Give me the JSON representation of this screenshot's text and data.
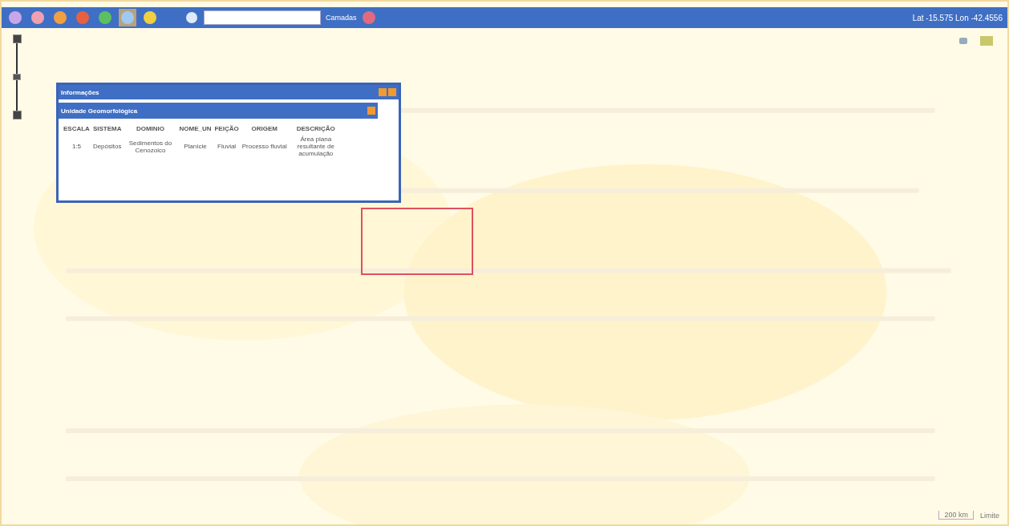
{
  "toolbar": {
    "tools": [
      {
        "color": "#c9a6e8",
        "selected": false
      },
      {
        "color": "#f0a0b0",
        "selected": false
      },
      {
        "color": "#f0a040",
        "selected": false
      },
      {
        "color": "#e86040",
        "selected": false
      },
      {
        "color": "#5cc060",
        "selected": false
      },
      {
        "color": "#a0c8f0",
        "selected": true
      },
      {
        "color": "#f0d040",
        "selected": false
      }
    ],
    "zoom": {
      "level": 0.5
    },
    "layers_label": "Camadas",
    "coordinates": "Lat -15.575 Lon -42.4556"
  },
  "popup": {
    "title": "Informações",
    "section": "Unidade Geomorfológica",
    "columns": [
      "ESCALA",
      "SISTEMA",
      "DOMINIO",
      "NOME_UN",
      "FEIÇÃO",
      "ORIGEM",
      "DESCRIÇÃO"
    ],
    "rows": [
      [
        "1:5",
        "Depósitos",
        "Sedimentos do Cenozoico",
        "Planície",
        "Fluvial",
        "Processo fluvial",
        "Área plana resultante de acumulação"
      ]
    ]
  },
  "scale": {
    "label": "200 km",
    "unit": "Limite"
  }
}
